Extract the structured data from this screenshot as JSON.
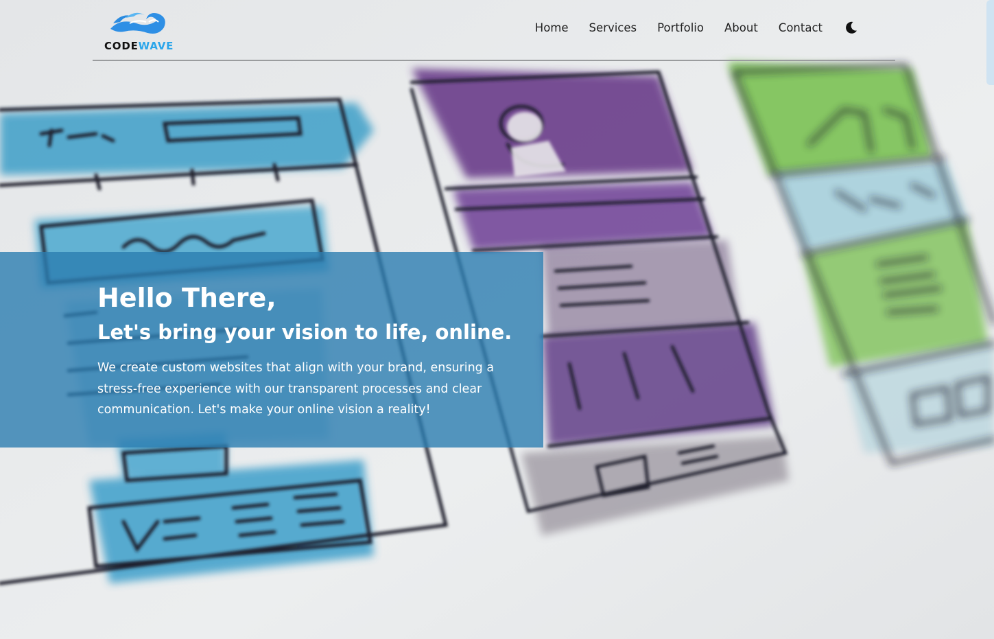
{
  "brand": {
    "name_part1": "CODE",
    "name_part2": "WAVE",
    "accent_color": "#2aa5ea"
  },
  "nav": {
    "items": [
      {
        "label": "Home"
      },
      {
        "label": "Services"
      },
      {
        "label": "Portfolio"
      },
      {
        "label": "About"
      },
      {
        "label": "Contact"
      }
    ],
    "theme_toggle_icon": "moon-icon"
  },
  "hero": {
    "title": "Hello There,",
    "subtitle": "Let's bring your vision to life, online.",
    "text": "We create custom websites that align with your brand, ensuring a stress-free experience with our transparent processes and clear communication. Let's make your online vision a reality!",
    "overlay_color": "#2c7db0",
    "background_image": "watercolor wireframe sketches"
  }
}
